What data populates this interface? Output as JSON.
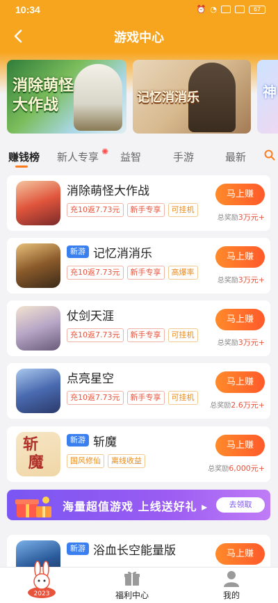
{
  "status_bar": {
    "time": "10:34",
    "battery": "67"
  },
  "nav": {
    "title": "游戏中心"
  },
  "banners": [
    {
      "title": "消除萌怪大作战",
      "line1": "消除萌怪",
      "line2": "大作战"
    },
    {
      "title": "记忆消消乐"
    },
    {
      "title": "神"
    }
  ],
  "tabs": [
    "赚钱榜",
    "新人专享",
    "益智",
    "手游",
    "最新"
  ],
  "games": [
    {
      "name": "消除萌怪大作战",
      "is_new": false,
      "new_label": "",
      "tags": [
        {
          "text": "充10返7.73元",
          "color": "red"
        },
        {
          "text": "新手专享",
          "color": "red"
        },
        {
          "text": "可挂机",
          "color": "orange"
        }
      ],
      "button": "马上赚",
      "reward_label": "总奖励",
      "reward_amount": "3万元+"
    },
    {
      "name": "记忆消消乐",
      "is_new": true,
      "new_label": "新游",
      "tags": [
        {
          "text": "充10返7.73元",
          "color": "red"
        },
        {
          "text": "新手专享",
          "color": "red"
        },
        {
          "text": "高爆率",
          "color": "orange"
        }
      ],
      "button": "马上赚",
      "reward_label": "总奖励",
      "reward_amount": "3万元+"
    },
    {
      "name": "仗剑天涯",
      "is_new": false,
      "new_label": "",
      "tags": [
        {
          "text": "充10返7.73元",
          "color": "red"
        },
        {
          "text": "新手专享",
          "color": "red"
        },
        {
          "text": "可挂机",
          "color": "orange"
        }
      ],
      "button": "马上赚",
      "reward_label": "总奖励",
      "reward_amount": "3万元+"
    },
    {
      "name": "点亮星空",
      "is_new": false,
      "new_label": "",
      "tags": [
        {
          "text": "充10返7.73元",
          "color": "red"
        },
        {
          "text": "新手专享",
          "color": "red"
        },
        {
          "text": "可挂机",
          "color": "orange"
        }
      ],
      "button": "马上赚",
      "reward_label": "总奖励",
      "reward_amount": "2.6万元+"
    },
    {
      "name": "斩魔",
      "is_new": true,
      "new_label": "新游",
      "tags": [
        {
          "text": "国风修仙",
          "color": "orange"
        },
        {
          "text": "离线收益",
          "color": "orange"
        }
      ],
      "button": "马上赚",
      "reward_label": "总奖励",
      "reward_amount": "6,000元+"
    },
    {
      "name": "浴血长空能量版",
      "is_new": true,
      "new_label": "新游",
      "tags": [],
      "button": "马上赚",
      "reward_label": "",
      "reward_amount": ""
    }
  ],
  "promo": {
    "text": "海量超值游戏  上线送好礼 ▸",
    "claim": "去领取"
  },
  "bottom_nav": [
    {
      "label": "",
      "icon": "rabbit-2023-icon",
      "year": "2023"
    },
    {
      "label": "福利中心",
      "icon": "gift-icon"
    },
    {
      "label": "我的",
      "icon": "user-icon"
    }
  ],
  "colors": {
    "header": "#f7a51f",
    "accent": "#ff6a2a",
    "new_badge": "#3a7ff0",
    "promo": "#7a56f2"
  }
}
